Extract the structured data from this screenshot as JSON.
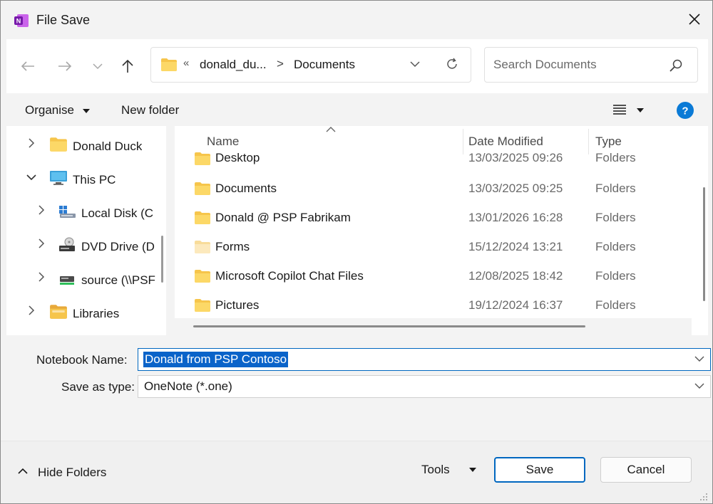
{
  "window": {
    "title": "File Save",
    "app_icon": "onenote-icon",
    "close_icon": "close-icon"
  },
  "address_bar": {
    "overflow": "«",
    "crumbs": [
      "donald_du...",
      "Documents"
    ],
    "separator": ">"
  },
  "search": {
    "placeholder": "Search Documents"
  },
  "commands": {
    "organise": "Organise",
    "new_folder": "New folder"
  },
  "nav_pane": {
    "items": [
      {
        "label": "Donald Duck",
        "icon": "folder-icon",
        "expanded": false
      },
      {
        "label": "This PC",
        "icon": "computer-icon",
        "expanded": true
      },
      {
        "label": "Local Disk (C",
        "icon": "local-disk-icon",
        "expanded": false
      },
      {
        "label": "DVD Drive (D",
        "icon": "dvd-drive-icon",
        "expanded": false
      },
      {
        "label": "source (\\\\PSF",
        "icon": "network-drive-icon",
        "expanded": false
      },
      {
        "label": "Libraries",
        "icon": "libraries-icon",
        "expanded": false
      }
    ]
  },
  "file_list": {
    "columns": [
      "Name",
      "Date Modified",
      "Type"
    ],
    "rows": [
      {
        "name": "Desktop",
        "date": "13/03/2025 09:26",
        "type": "Folders"
      },
      {
        "name": "Documents",
        "date": "13/03/2025 09:25",
        "type": "Folders"
      },
      {
        "name": "Donald @ PSP Fabrikam",
        "date": "13/01/2026 16:28",
        "type": "Folders"
      },
      {
        "name": "Forms",
        "date": "15/12/2024 13:21",
        "type": "Folders"
      },
      {
        "name": "Microsoft Copilot Chat Files",
        "date": "12/08/2025 18:42",
        "type": "Folders"
      },
      {
        "name": "Pictures",
        "date": "19/12/2024 16:37",
        "type": "Folders"
      }
    ]
  },
  "form": {
    "notebook_label": "Notebook Name:",
    "notebook_value": "Donald from PSP Contoso",
    "type_label": "Save as type:",
    "type_value": "OneNote (*.one)"
  },
  "footer": {
    "hide_folders": "Hide Folders",
    "tools": "Tools",
    "save": "Save",
    "cancel": "Cancel"
  },
  "colors": {
    "accent": "#0067c0",
    "selection": "#0a63c9",
    "folder": "#f6c54b",
    "onenote": "#7719aa",
    "help": "#0a7ad6"
  }
}
